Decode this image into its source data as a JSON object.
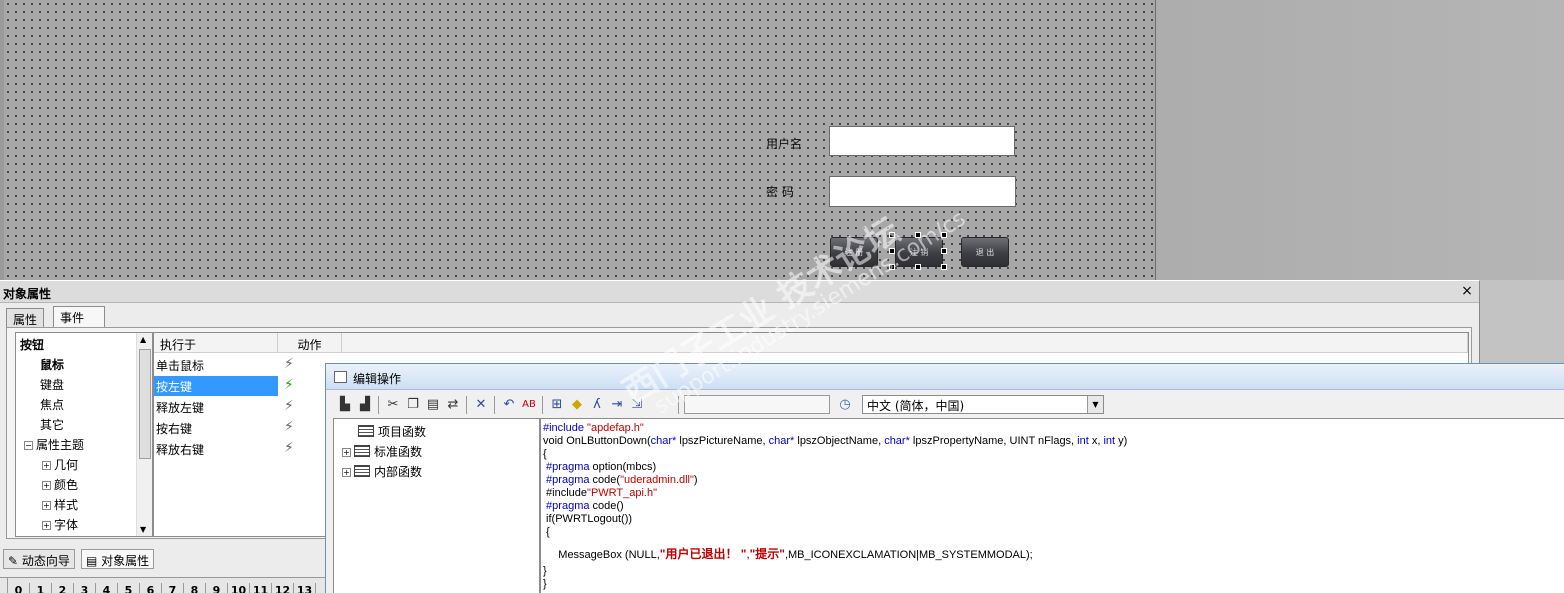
{
  "canvas": {
    "username_label": "用户名",
    "password_label": "密  码",
    "buttons": [
      "注 册",
      "注 销",
      "退 出"
    ]
  },
  "watermark": {
    "line1": "西门子工业  技术论坛",
    "line2": "support.industry.siemens.com/cs"
  },
  "object_panel": {
    "title": "对象属性",
    "close": "×",
    "tabs": [
      "属性",
      "事件"
    ],
    "active_tab": "事件",
    "tree": [
      {
        "label": "按钮",
        "bold": true
      },
      {
        "label": "鼠标",
        "bold": true
      },
      {
        "label": "键盘"
      },
      {
        "label": "焦点"
      },
      {
        "label": "其它"
      },
      {
        "label": "属性主题",
        "expand": "⊟"
      },
      {
        "label": "几何",
        "expand": "⊞"
      },
      {
        "label": "颜色",
        "expand": "⊞"
      },
      {
        "label": "样式",
        "expand": "⊞"
      },
      {
        "label": "字体",
        "expand": "⊞"
      }
    ],
    "columns": [
      "执行于",
      "动作"
    ],
    "events": [
      "单击鼠标",
      "按左键",
      "释放左键",
      "按右键",
      "释放右键"
    ],
    "selected_event": "按左键",
    "bottom_tabs": [
      "动态向导",
      "对象属性"
    ],
    "ruler": [
      "0",
      "1",
      "2",
      "3",
      "4",
      "5",
      "6",
      "7",
      "8",
      "9",
      "10",
      "11",
      "12",
      "13"
    ]
  },
  "edit_window": {
    "title": "编辑操作",
    "language": "中文 (简体，中国)",
    "func_tree": [
      "项目函数",
      "标准函数",
      "内部函数"
    ],
    "code": {
      "l1_kw": "#include ",
      "l1_str": "\"apdefap.h\"",
      "l2_a": "void OnLButtonDown(",
      "l2_b": "char*",
      "l2_c": " lpszPictureName, ",
      "l2_d": "char*",
      "l2_e": " lpszObjectName, ",
      "l2_f": "char*",
      "l2_g": " lpszPropertyName, UINT nFlags, ",
      "l2_h": "int",
      "l2_i": " x, ",
      "l2_j": "int",
      "l2_k": " y)",
      "l3": "{",
      "l4_kw": " #pragma",
      "l4_rest": " option(mbcs)",
      "l5_kw": " #pragma",
      "l5_a": " code(",
      "l5_str": "\"uderadmin.dll\"",
      "l5_b": ")",
      "l6_a": " #include",
      "l6_str": "\"PWRT_api.h\"",
      "l7_kw": " #pragma",
      "l7_rest": " code()",
      "l8": " if(PWRTLogout())",
      "l9": " {",
      "l10_a": "     MessageBox (NULL,",
      "l10_zh1": "\"用户已退出！ \"",
      "l10_b": ",",
      "l10_zh2": "\"提示\"",
      "l10_c": ",MB_ICONEXCLAMATION|MB_SYSTEMMODAL);",
      "l11": "}",
      "l12": "}"
    }
  }
}
